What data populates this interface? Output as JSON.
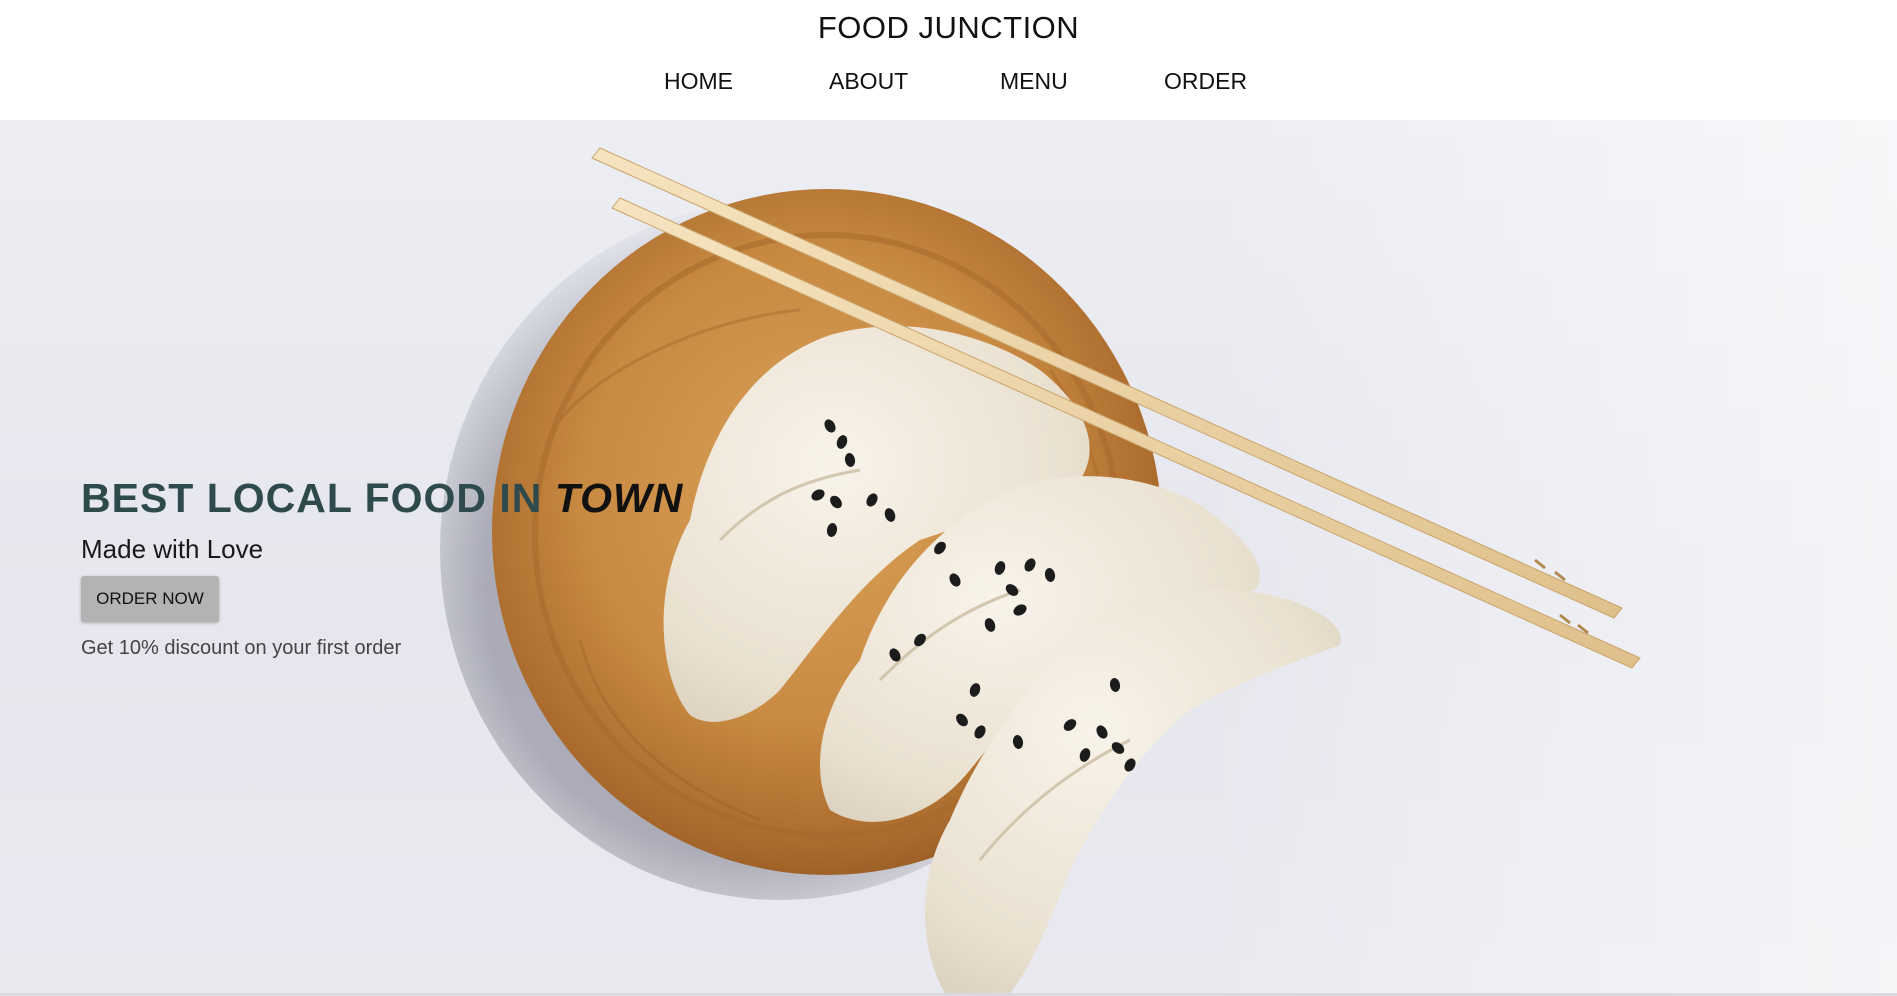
{
  "header": {
    "brand": "FOOD JUNCTION",
    "nav": [
      {
        "label": "HOME"
      },
      {
        "label": "ABOUT"
      },
      {
        "label": "MENU"
      },
      {
        "label": "ORDER"
      }
    ]
  },
  "hero": {
    "headline_main": "BEST LOCAL FOOD IN ",
    "headline_accent": "TOWN",
    "tagline": "Made with Love",
    "order_button": "ORDER NOW",
    "discount_text": "Get 10% discount on your first order",
    "image_subject": "dumplings-on-wooden-plate-with-chopsticks",
    "colors": {
      "headline": "#2f4a4c",
      "accent": "#111111",
      "button_bg": "#b3b3b3",
      "wood": "#c98a42",
      "dumpling": "#eee6d8",
      "chopstick": "#efd6a8"
    }
  }
}
